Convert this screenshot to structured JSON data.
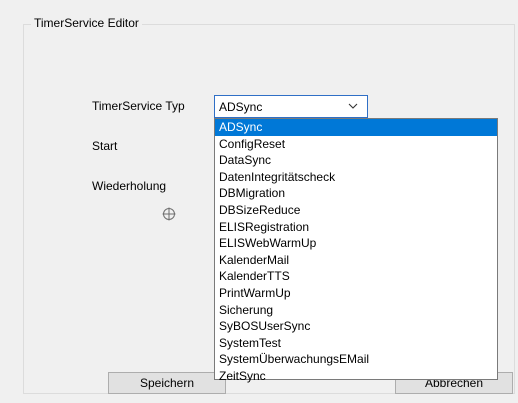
{
  "editor": {
    "title": "TimerService Editor"
  },
  "form": {
    "type_label": "TimerService Typ",
    "start_label": "Start",
    "repeat_label": "Wiederholung"
  },
  "combo": {
    "selected": "ADSync",
    "arrow_icon": "chevron-down-icon"
  },
  "dropdown": {
    "options": [
      "ADSync",
      "ConfigReset",
      "DataSync",
      "DatenIntegritätscheck",
      "DBMigration",
      "DBSizeReduce",
      "ELISRegistration",
      "ELISWebWarmUp",
      "KalenderMail",
      "KalenderTTS",
      "PrintWarmUp",
      "Sicherung",
      "SyBOSUserSync",
      "SystemTest",
      "SystemÜberwachungsEMail",
      "ZeitSync"
    ],
    "selected_index": 0
  },
  "buttons": {
    "save": "Speichern",
    "cancel": "Abbrechen"
  },
  "colors": {
    "selection": "#0078d7",
    "focus_border": "#2f6fc6"
  }
}
